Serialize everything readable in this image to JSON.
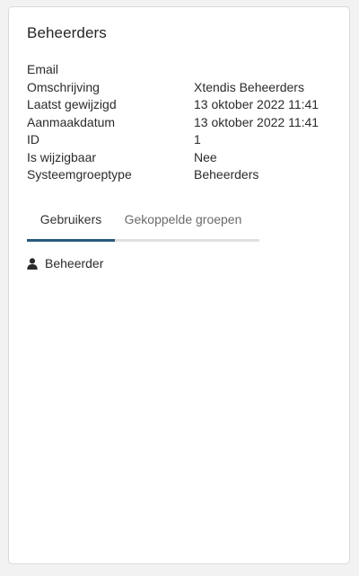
{
  "card": {
    "title": "Beheerders"
  },
  "properties": [
    {
      "label": "Email",
      "value": ""
    },
    {
      "label": "Omschrijving",
      "value": "Xtendis Beheerders"
    },
    {
      "label": "Laatst gewijzigd",
      "value": "13 oktober 2022 11:41"
    },
    {
      "label": "Aanmaakdatum",
      "value": "13 oktober 2022 11:41"
    },
    {
      "label": "ID",
      "value": "1"
    },
    {
      "label": "Is wijzigbaar",
      "value": "Nee"
    },
    {
      "label": "Systeemgroeptype",
      "value": "Beheerders"
    }
  ],
  "tabs": [
    {
      "label": "Gebruikers",
      "active": true
    },
    {
      "label": "Gekoppelde groepen",
      "active": false
    }
  ],
  "members": [
    {
      "name": "Beheerder",
      "icon": "user-icon"
    }
  ],
  "colors": {
    "active_tab_underline": "#285a7e",
    "inactive_tab_underline": "#e0e0e0"
  }
}
